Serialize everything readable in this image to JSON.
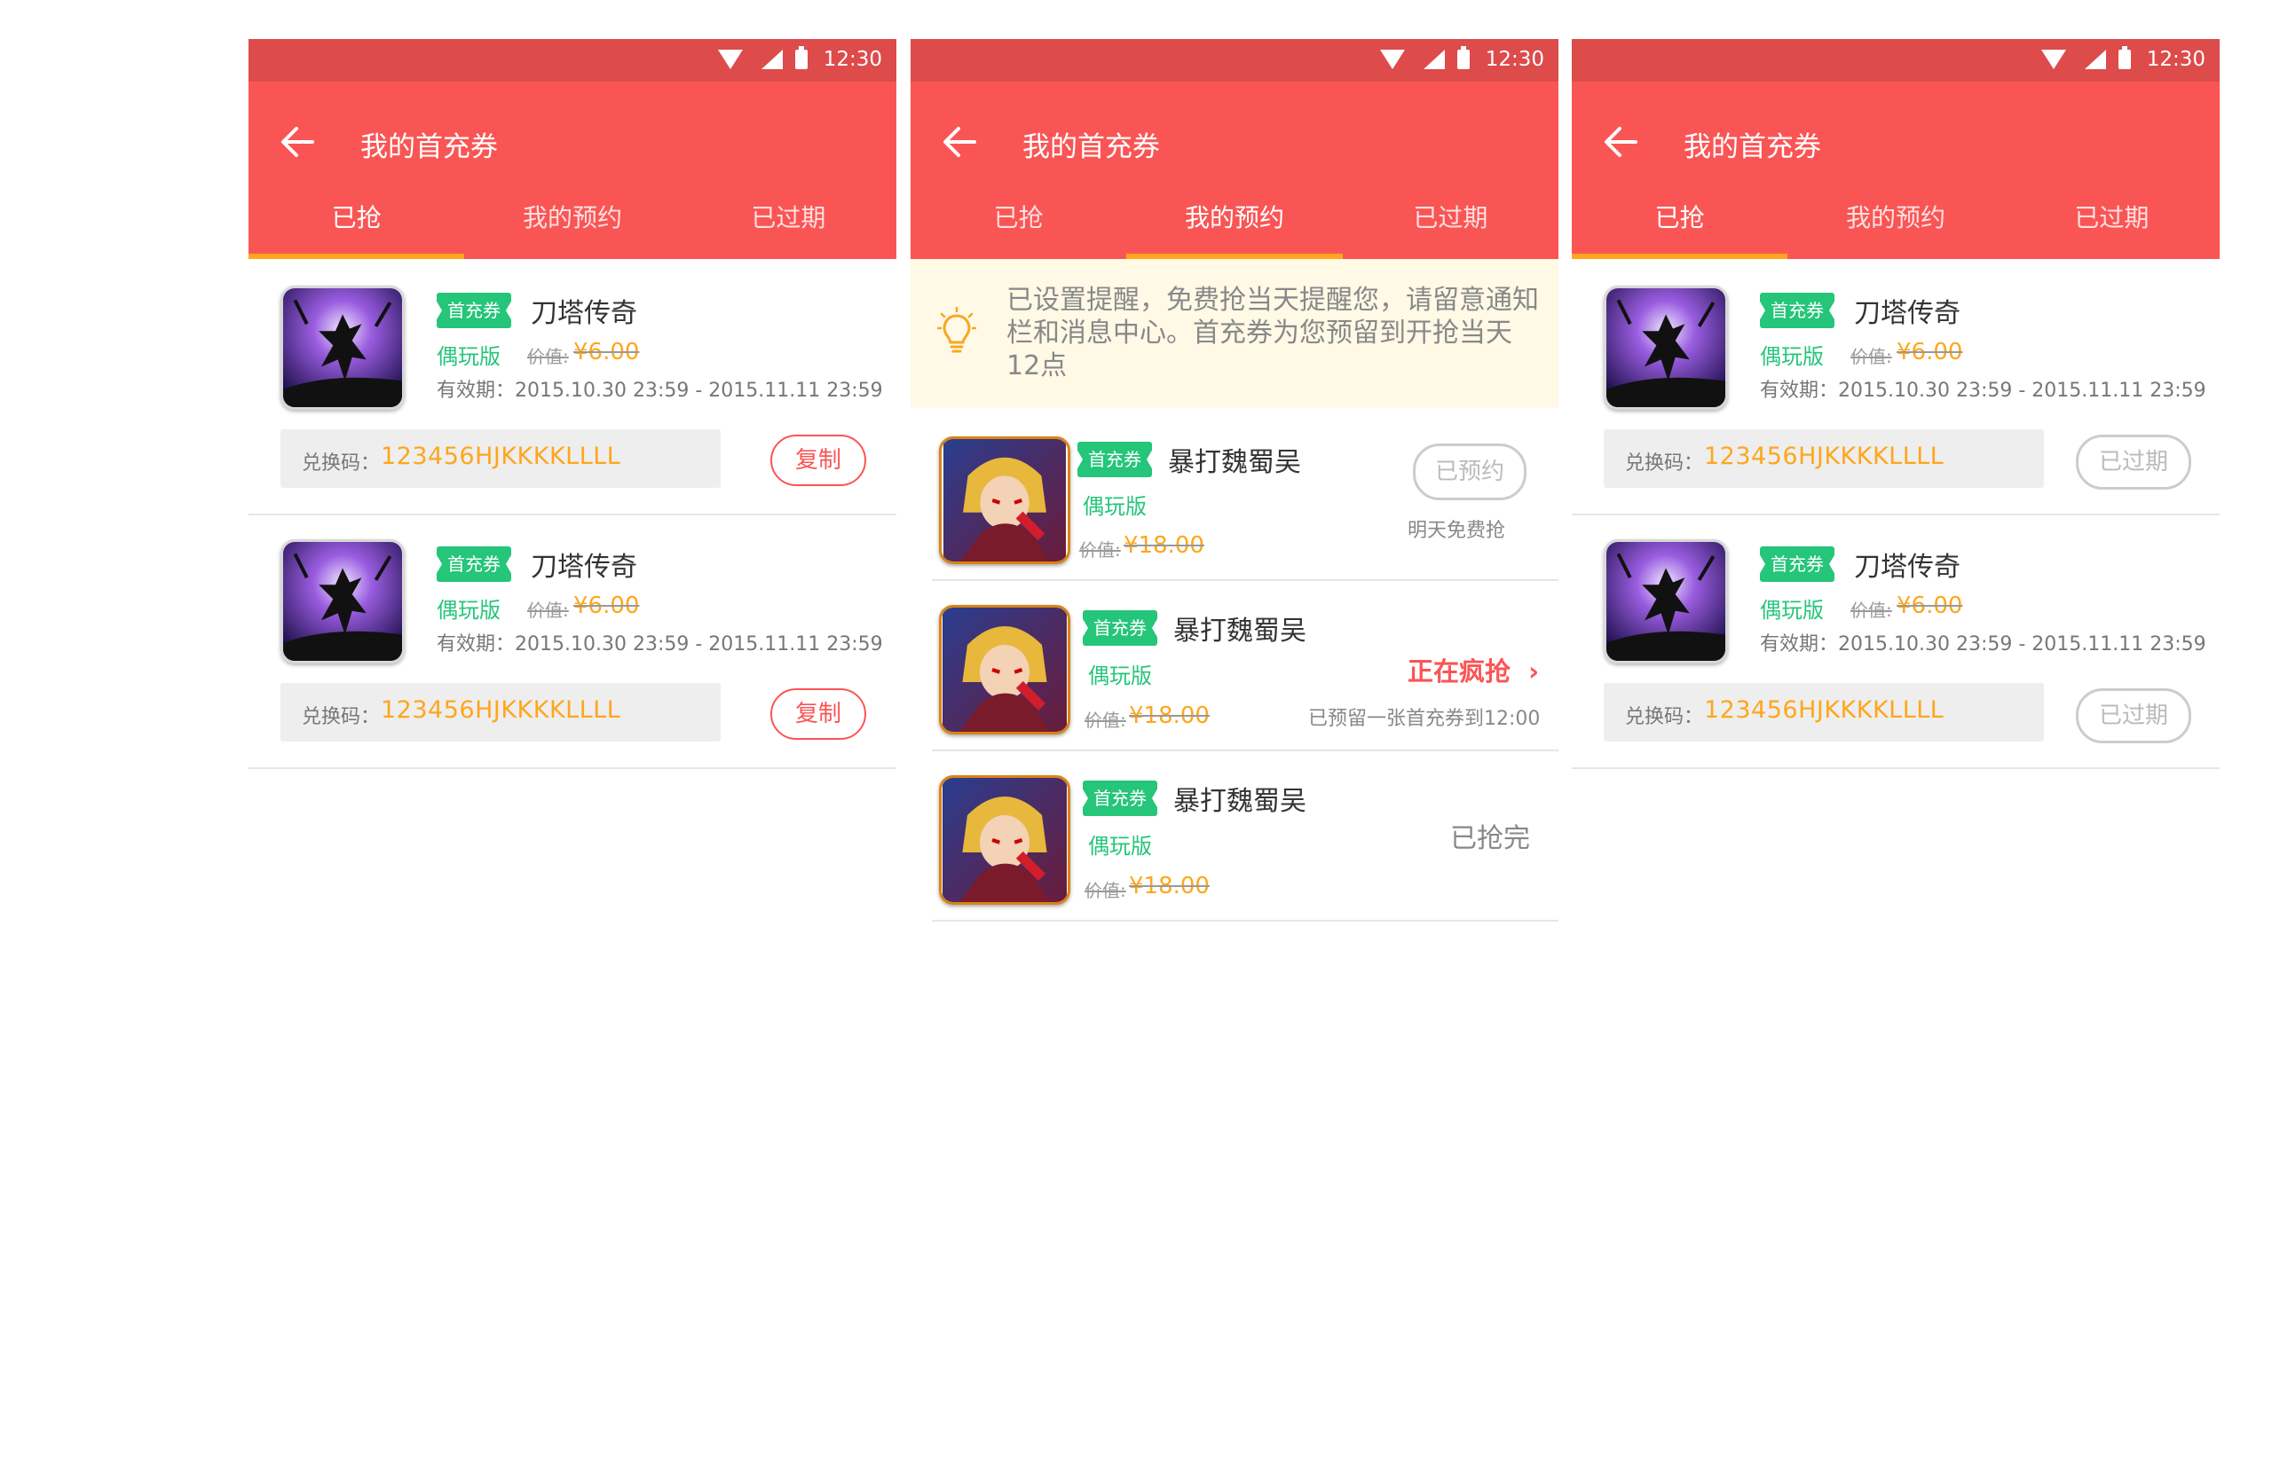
{
  "status_bar": {
    "time": "12:30"
  },
  "app": {
    "title": "我的首充券",
    "tabs": [
      "已抢",
      "我的预约",
      "已过期"
    ]
  },
  "colors": {
    "primary": "#fa5555",
    "status_bar": "#dd4b4b",
    "accent": "#ffa61c",
    "badge_green": "#25c57a",
    "notice_bg": "#fff9e6"
  },
  "common": {
    "coupon_badge": "首充券",
    "version": "偶玩版",
    "price_label": "价值:",
    "code_label": "兑换码："
  },
  "claimed_items": [
    {
      "game": "刀塔传奇",
      "price": "¥6.00",
      "validity": "有效期：2015.10.30  23:59 - 2015.11.11  23:59",
      "code": "123456HJKKKKLLLL",
      "action": "复制"
    },
    {
      "game": "刀塔传奇",
      "price": "¥6.00",
      "validity": "有效期：2015.10.30  23:59 - 2015.11.11  23:59",
      "code": "123456HJKKKKLLLL",
      "action": "复制"
    }
  ],
  "reservation_notice": "已设置提醒，免费抢当天提醒您，请留意通知栏和消息中心。首充券为您预留到开抢当天12点",
  "reservations": [
    {
      "game": "暴打魏蜀吴",
      "price": "¥18.00",
      "button": "已预约",
      "hint": "明天免费抢"
    },
    {
      "game": "暴打魏蜀吴",
      "price": "¥18.00",
      "link": "正在疯抢",
      "chevron": "›",
      "hint": "已预留一张首充券到12:00"
    },
    {
      "game": "暴打魏蜀吴",
      "price": "¥18.00",
      "status": "已抢完"
    }
  ],
  "expired_items": [
    {
      "game": "刀塔传奇",
      "price": "¥6.00",
      "validity": "有效期：2015.10.30  23:59 - 2015.11.11  23:59",
      "code": "123456HJKKKKLLLL",
      "action": "已过期"
    },
    {
      "game": "刀塔传奇",
      "price": "¥6.00",
      "validity": "有效期：2015.10.30  23:59 - 2015.11.11  23:59",
      "code": "123456HJKKKKLLLL",
      "action": "已过期"
    }
  ],
  "icons": {
    "back": "arrow-left-icon",
    "wifi": "wifi-icon",
    "signal": "signal-icon",
    "battery": "battery-icon",
    "bulb": "lightbulb-icon"
  }
}
